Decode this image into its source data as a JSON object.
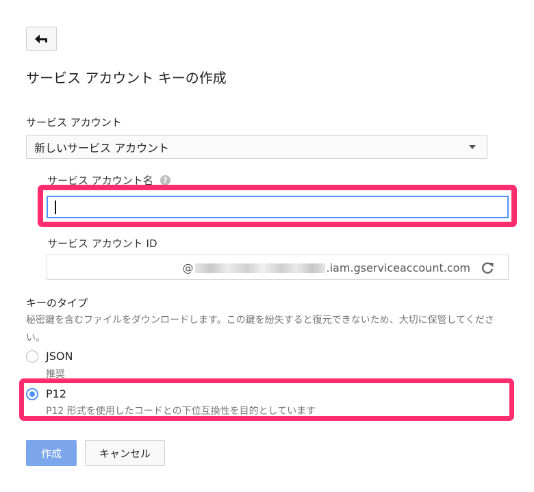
{
  "header": {
    "back_icon": "back-arrow-icon",
    "title": "サービス アカウント キーの作成"
  },
  "service_account": {
    "label": "サービス アカウント",
    "selected": "新しいサービス アカウント",
    "caret_icon": "dropdown-caret-icon"
  },
  "account_name": {
    "label": "サービス アカウント名",
    "help_icon": "help-icon",
    "help_glyph": "?",
    "value": ""
  },
  "account_id": {
    "label": "サービス アカウント ID",
    "prefix": "@",
    "suffix": ".iam.gserviceaccount.com",
    "refresh_icon": "refresh-icon"
  },
  "key_type": {
    "label": "キーのタイプ",
    "description": "秘密鍵を含むファイルをダウンロードします。この鍵を紛失すると復元できないため、大切に保管してください。",
    "options": [
      {
        "label": "JSON",
        "sub": "推奨",
        "checked": false
      },
      {
        "label": "P12",
        "sub": "P12 形式を使用したコードとの下位互換性を目的としています",
        "checked": true
      }
    ]
  },
  "actions": {
    "create": "作成",
    "cancel": "キャンセル"
  },
  "colors": {
    "highlight": "#ff2d6f",
    "accent": "#4d90fe",
    "primary_button": "#7ca6ec"
  }
}
